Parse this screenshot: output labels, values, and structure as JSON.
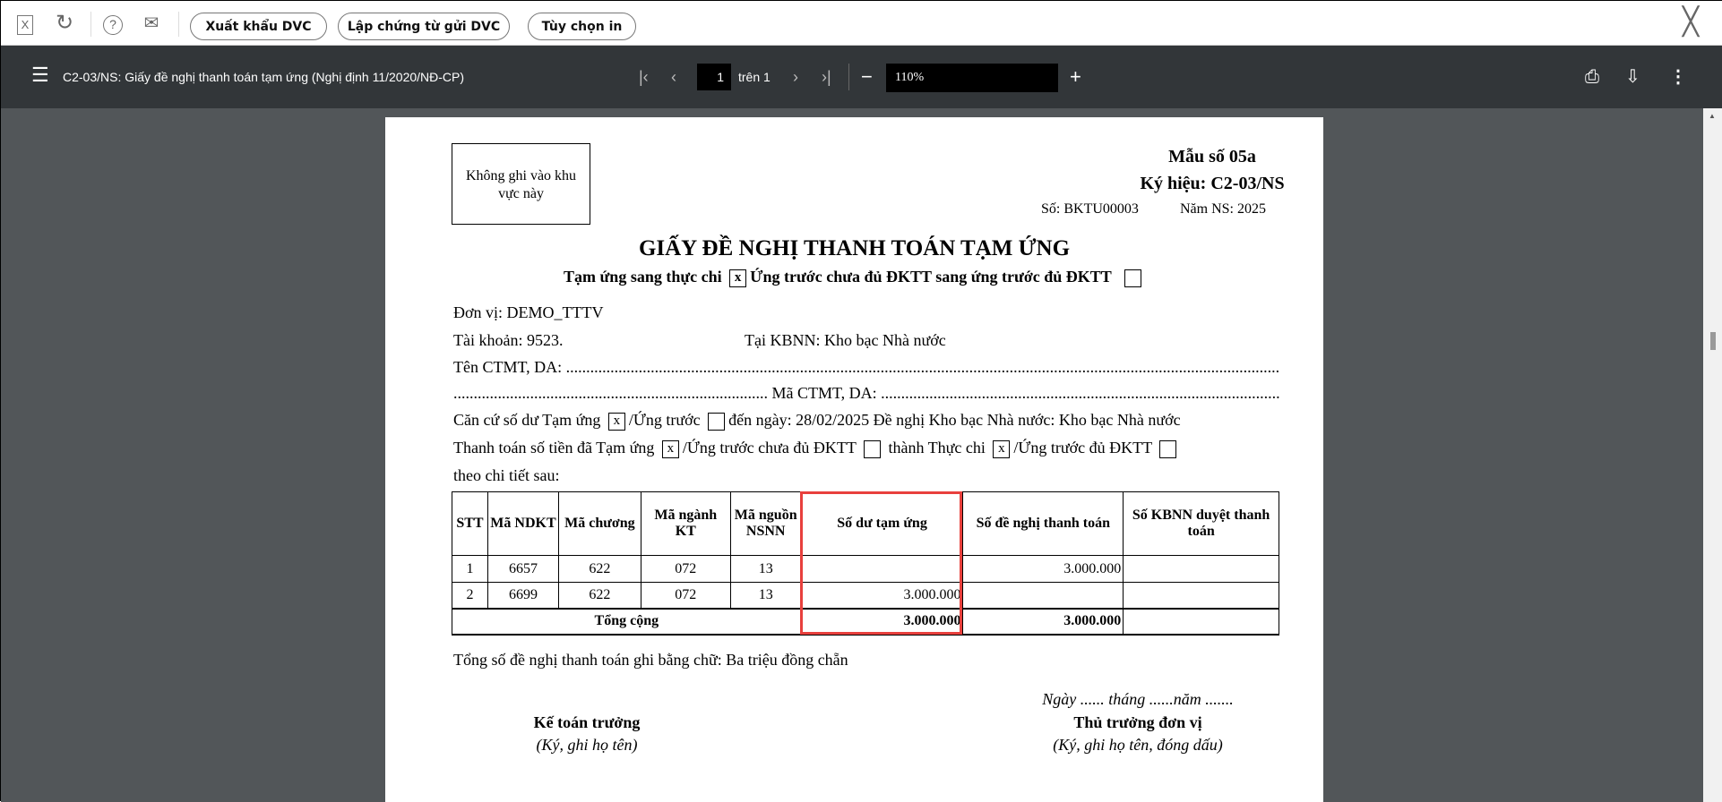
{
  "toolbar": {
    "buttons": [
      "Xuất khẩu DVC",
      "Lập chứng từ gửi DVC",
      "Tùy chọn in"
    ],
    "icons": [
      "excel-icon",
      "refresh-icon",
      "help-icon",
      "email-icon",
      "close-icon"
    ]
  },
  "viewer": {
    "title": "C2-03/NS: Giấy đề nghị thanh toán tạm ứng (Nghị định 11/2020/NĐ-CP)",
    "page": "1",
    "page_of": "trên 1",
    "zoom": "110%"
  },
  "doc": {
    "box": "Không ghi vào khu vực này",
    "form_no": "Mẫu số 05a",
    "symbol": "Ký hiệu: C2-03/NS",
    "number": "Số: BKTU00003",
    "year": "Năm NS: 2025",
    "title": "GIẤY ĐỀ NGHỊ THANH TOÁN TẠM ỨNG",
    "sub1": "Tạm ứng sang thực chi",
    "sub2": "Ứng trước chưa đủ ĐKTT sang ứng trước đủ ĐKTT",
    "x": "x",
    "unit": "Đơn vị: DEMO_TTTV",
    "account": "Tài khoản: 9523.",
    "kbnn": "Tại KBNN: Kho bạc Nhà nước",
    "ctmt_name": "Tên CTMT, DA:",
    "ctmt_code": "Mã CTMT, DA:",
    "line1": {
      "a": "Căn cứ số dư Tạm ứng",
      "b": "/Ứng trước",
      "c": "đến ngày: 28/02/2025   Đề nghị Kho bạc Nhà nước: Kho bạc Nhà nước"
    },
    "line2": {
      "a": "Thanh toán số tiền đã Tạm ứng",
      "b": "/Ứng trước chưa đủ ĐKTT",
      "c": "thành Thực chi",
      "d": "/Ứng trước đủ ĐKTT"
    },
    "detail": "theo chi tiết sau:",
    "headers": [
      "STT",
      "Mã NDKT",
      "Mã chương",
      "Mã ngành KT",
      "Mã nguồn NSNN",
      "Số dư tạm ứng",
      "Số đề nghị thanh toán",
      "Số KBNN duyệt thanh toán"
    ],
    "rows": [
      [
        "1",
        "6657",
        "622",
        "072",
        "13",
        "",
        "3.000.000",
        ""
      ],
      [
        "2",
        "6699",
        "622",
        "072",
        "13",
        "3.000.000",
        "",
        ""
      ]
    ],
    "total": {
      "label": "Tổng cộng",
      "balance": "3.000.000",
      "request": "3.000.000"
    },
    "in_words": "Tổng số đề nghị thanh toán ghi bằng chữ: Ba triệu đồng chẵn",
    "date_line": "Ngày ...... tháng ......năm .......",
    "sign1": {
      "title": "Kế toán trưởng",
      "note": "(Ký, ghi họ tên)"
    },
    "sign2": {
      "title": "Thủ trưởng đơn vị",
      "note": "(Ký, ghi họ tên, đóng dấu)"
    }
  }
}
